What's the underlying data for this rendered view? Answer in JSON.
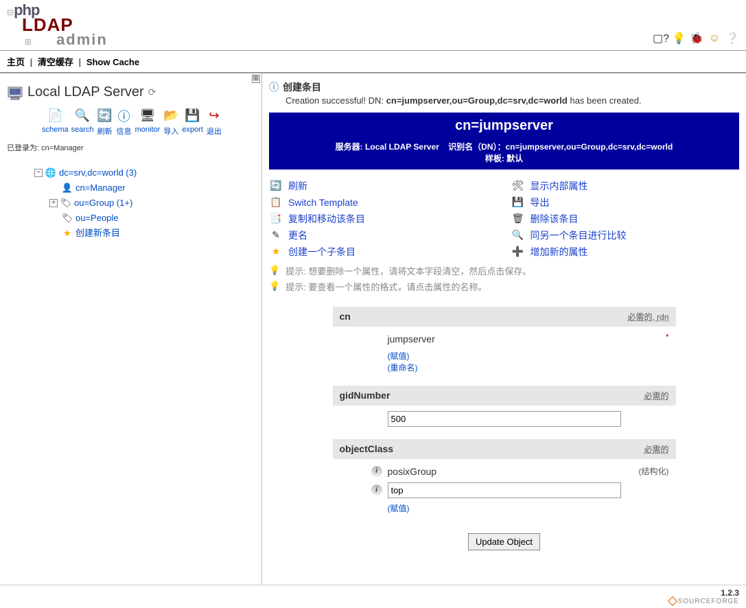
{
  "logo": {
    "line1": "php",
    "line2": "LDAP",
    "line3": "admin"
  },
  "menubar": {
    "home": "主页",
    "purge": "清空缓存",
    "show_cache": "Show Cache"
  },
  "server": {
    "title": "Local LDAP Server",
    "logged_in": "已登录为: cn=Manager"
  },
  "toolbar": {
    "schema": "schema",
    "search": "search",
    "refresh": "刷新",
    "info": "信息",
    "monitor": "monitor",
    "import": "导入",
    "export": "export",
    "logout": "退出"
  },
  "tree": {
    "root": "dc=srv,dc=world (3)",
    "items": [
      {
        "label": "cn=Manager"
      },
      {
        "label": "ou=Group (1+)"
      },
      {
        "label": "ou=People"
      },
      {
        "label": "创建新条目"
      }
    ]
  },
  "message": {
    "title": "创建条目",
    "text_before": "Creation successful! DN: ",
    "dn": "cn=jumpserver,ou=Group,dc=srv,dc=world",
    "text_after": " has been created."
  },
  "titlebar": {
    "main": "cn=jumpserver",
    "server_label": "服务器: Local LDAP Server",
    "dn_label": "识别名（DN）：",
    "dn": "cn=jumpserver,ou=Group,dc=srv,dc=world",
    "template": "样板: 默认"
  },
  "actions": {
    "refresh": "刷新",
    "show_internal": "显示内部属性",
    "switch_template": "Switch Template",
    "export": "导出",
    "copy_move": "复制和移动该条目",
    "delete": "删除该条目",
    "rename": "更名",
    "compare": "同另一个条目进行比较",
    "create_child": "创建一个子条目",
    "add_attr": "增加新的属性"
  },
  "hints": {
    "h1": "提示:   想要删除一个属性，请将文本字段清空，然后点击保存。",
    "h2": "提示:   要查看一个属性的格式，请点击属性的名称。"
  },
  "attrs": {
    "required": "必需的",
    "rdn": "rdn",
    "cn": {
      "label": "cn",
      "value": "jumpserver",
      "add": "(赋值)",
      "rename": "(重命名)"
    },
    "gid": {
      "label": "gidNumber",
      "value": "500"
    },
    "oc": {
      "label": "objectClass",
      "v1": "posixGroup",
      "structural": "(结构化)",
      "v2": "top",
      "add": "(赋值)"
    }
  },
  "update_button": "Update Object",
  "footer": {
    "version": "1.2.3",
    "sf": "SOURCEFORGE"
  }
}
